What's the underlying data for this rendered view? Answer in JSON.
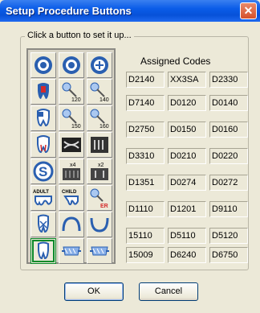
{
  "window": {
    "title": "Setup Procedure Buttons",
    "close_label": "✕"
  },
  "group": {
    "label": "Click a button to set it up..."
  },
  "codes": {
    "header": "Assigned Codes",
    "rows": [
      [
        "D2140",
        "XX3SA",
        "D2330"
      ],
      [
        "D7140",
        "D0120",
        "D0140"
      ],
      [
        "D2750",
        "D0150",
        "D0160"
      ],
      [
        "D3310",
        "D0210",
        "D0220"
      ],
      [
        "D1351",
        "D0274",
        "D0272"
      ],
      [
        "D1110",
        "D1201",
        "D9110"
      ],
      [
        "15110",
        "D5110",
        "D5120"
      ],
      [
        "15009",
        "D6240",
        "D6750"
      ]
    ]
  },
  "tool_icons": [
    [
      "lifebuoy-icon",
      "lifebuoy-icon",
      "lifebuoy-icon"
    ],
    [
      "tooth-red-icon",
      "probe-120-icon",
      "probe-140-icon"
    ],
    [
      "tooth-outline-icon",
      "probe-150-icon",
      "probe-160-icon"
    ],
    [
      "tooth-root-icon",
      "xray-panoramic-icon",
      "xray-film-icon"
    ],
    [
      "sealant-s-icon",
      "xray-x4-icon",
      "xray-x2-icon"
    ],
    [
      "adult-prophy-icon",
      "child-prophy-icon",
      "probe-er-icon"
    ],
    [
      "extraction-icon",
      "arch-upper-icon",
      "arch-lower-icon"
    ],
    [
      "tooth-green-icon",
      "implant-icon",
      "implant-icon"
    ]
  ],
  "tool_labels": {
    "probe_120": "120",
    "probe_140": "140",
    "probe_150": "150",
    "probe_160": "160",
    "x4": "x4",
    "x2": "x2",
    "adult": "ADULT",
    "child": "CHILD",
    "er": "ER"
  },
  "buttons": {
    "ok": "OK",
    "cancel": "Cancel"
  },
  "colors": {
    "title_bar": "#0a5ce8",
    "close": "#d5502a",
    "icon_blue": "#2a5fb0"
  }
}
